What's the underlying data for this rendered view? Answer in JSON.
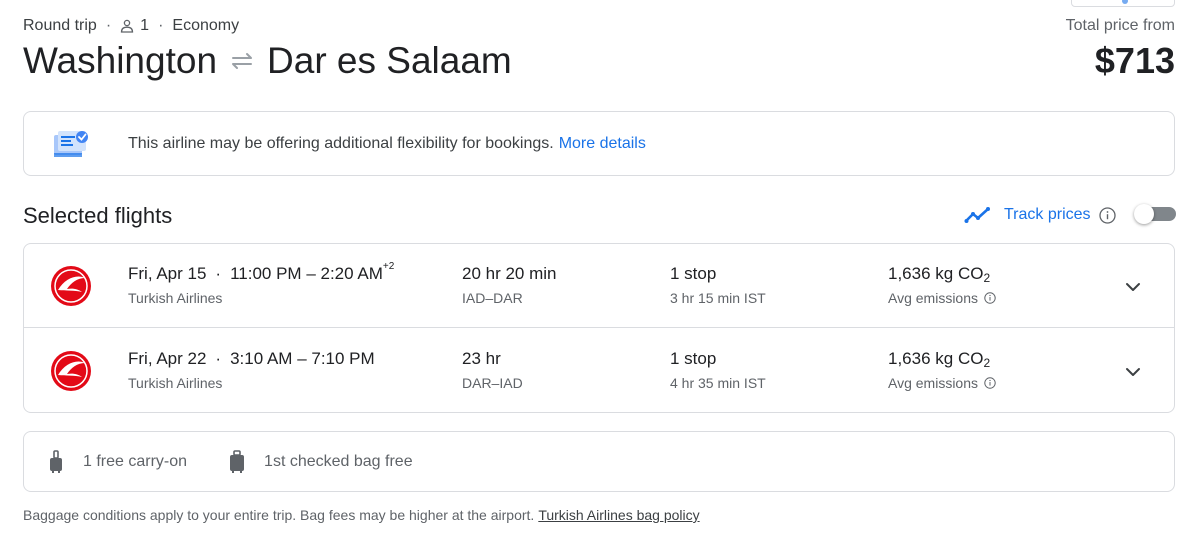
{
  "trip": {
    "type": "Round trip",
    "passengers": "1",
    "cabin": "Economy",
    "origin": "Washington",
    "destination": "Dar es Salaam"
  },
  "price": {
    "label": "Total price from",
    "value": "$713"
  },
  "notice": {
    "text": "This airline may be offering additional flexibility for bookings.",
    "link": "More details"
  },
  "selected_flights": {
    "title": "Selected flights",
    "track_label": "Track prices",
    "track_enabled": false
  },
  "flights": [
    {
      "date": "Fri, Apr 15",
      "time_range": "11:00 PM – 2:20 AM",
      "day_offset": "+2",
      "airline": "Turkish Airlines",
      "duration": "20 hr 20 min",
      "route": "IAD–DAR",
      "stops": "1 stop",
      "layover": "3 hr 15 min IST",
      "emissions_value": "1,636 kg CO",
      "emissions_sub": "2",
      "emissions_label": "Avg emissions"
    },
    {
      "date": "Fri, Apr 22",
      "time_range": "3:10 AM – 7:10 PM",
      "day_offset": "",
      "airline": "Turkish Airlines",
      "duration": "23 hr",
      "route": "DAR–IAD",
      "stops": "1 stop",
      "layover": "4 hr 35 min IST",
      "emissions_value": "1,636 kg CO",
      "emissions_sub": "2",
      "emissions_label": "Avg emissions"
    }
  ],
  "baggage": {
    "carry_on": "1 free carry-on",
    "checked": "1st checked bag free",
    "note": "Baggage conditions apply to your entire trip. Bag fees may be higher at the airport.",
    "policy_link": "Turkish Airlines bag policy"
  },
  "colors": {
    "accent": "#1a73e8",
    "airline_red": "#e30a17",
    "border": "#dadce0"
  }
}
